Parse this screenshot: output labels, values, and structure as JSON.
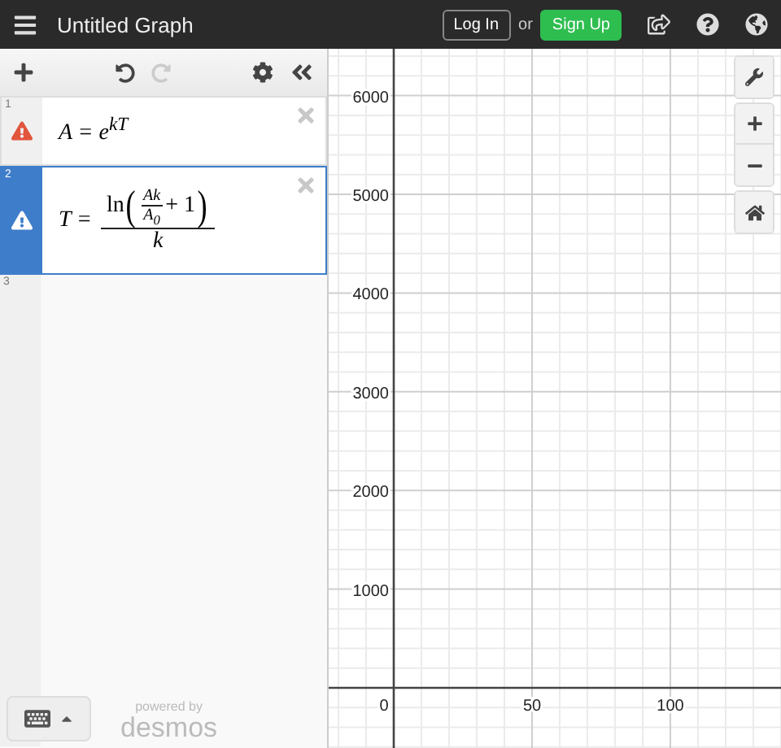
{
  "header": {
    "title": "Untitled Graph",
    "login": "Log In",
    "or": "or",
    "signup": "Sign Up"
  },
  "toolbar": {
    "undo_disabled": false,
    "redo_disabled": true
  },
  "expressions": [
    {
      "number": "1",
      "kind": "equation",
      "selected": false,
      "warning": true,
      "text": "A = e$^{kT}$"
    },
    {
      "number": "2",
      "kind": "fraction",
      "selected": true,
      "warning": true,
      "lhs": "T =",
      "function": "ln",
      "open": "(",
      "top": "Ak",
      "bottom": "A$_{0}$",
      "rest": "+ 1",
      "close": ")",
      "denominator": "k"
    },
    {
      "number": "3",
      "kind": "empty",
      "selected": false,
      "warning": false
    }
  ],
  "footer": {
    "powered": "powered by",
    "brand": "desmos"
  },
  "graph": {
    "y_ticks": [
      "6000",
      "5000",
      "4000",
      "3000",
      "2000",
      "1000"
    ],
    "x_ticks": [
      "0",
      "50",
      "100"
    ]
  }
}
